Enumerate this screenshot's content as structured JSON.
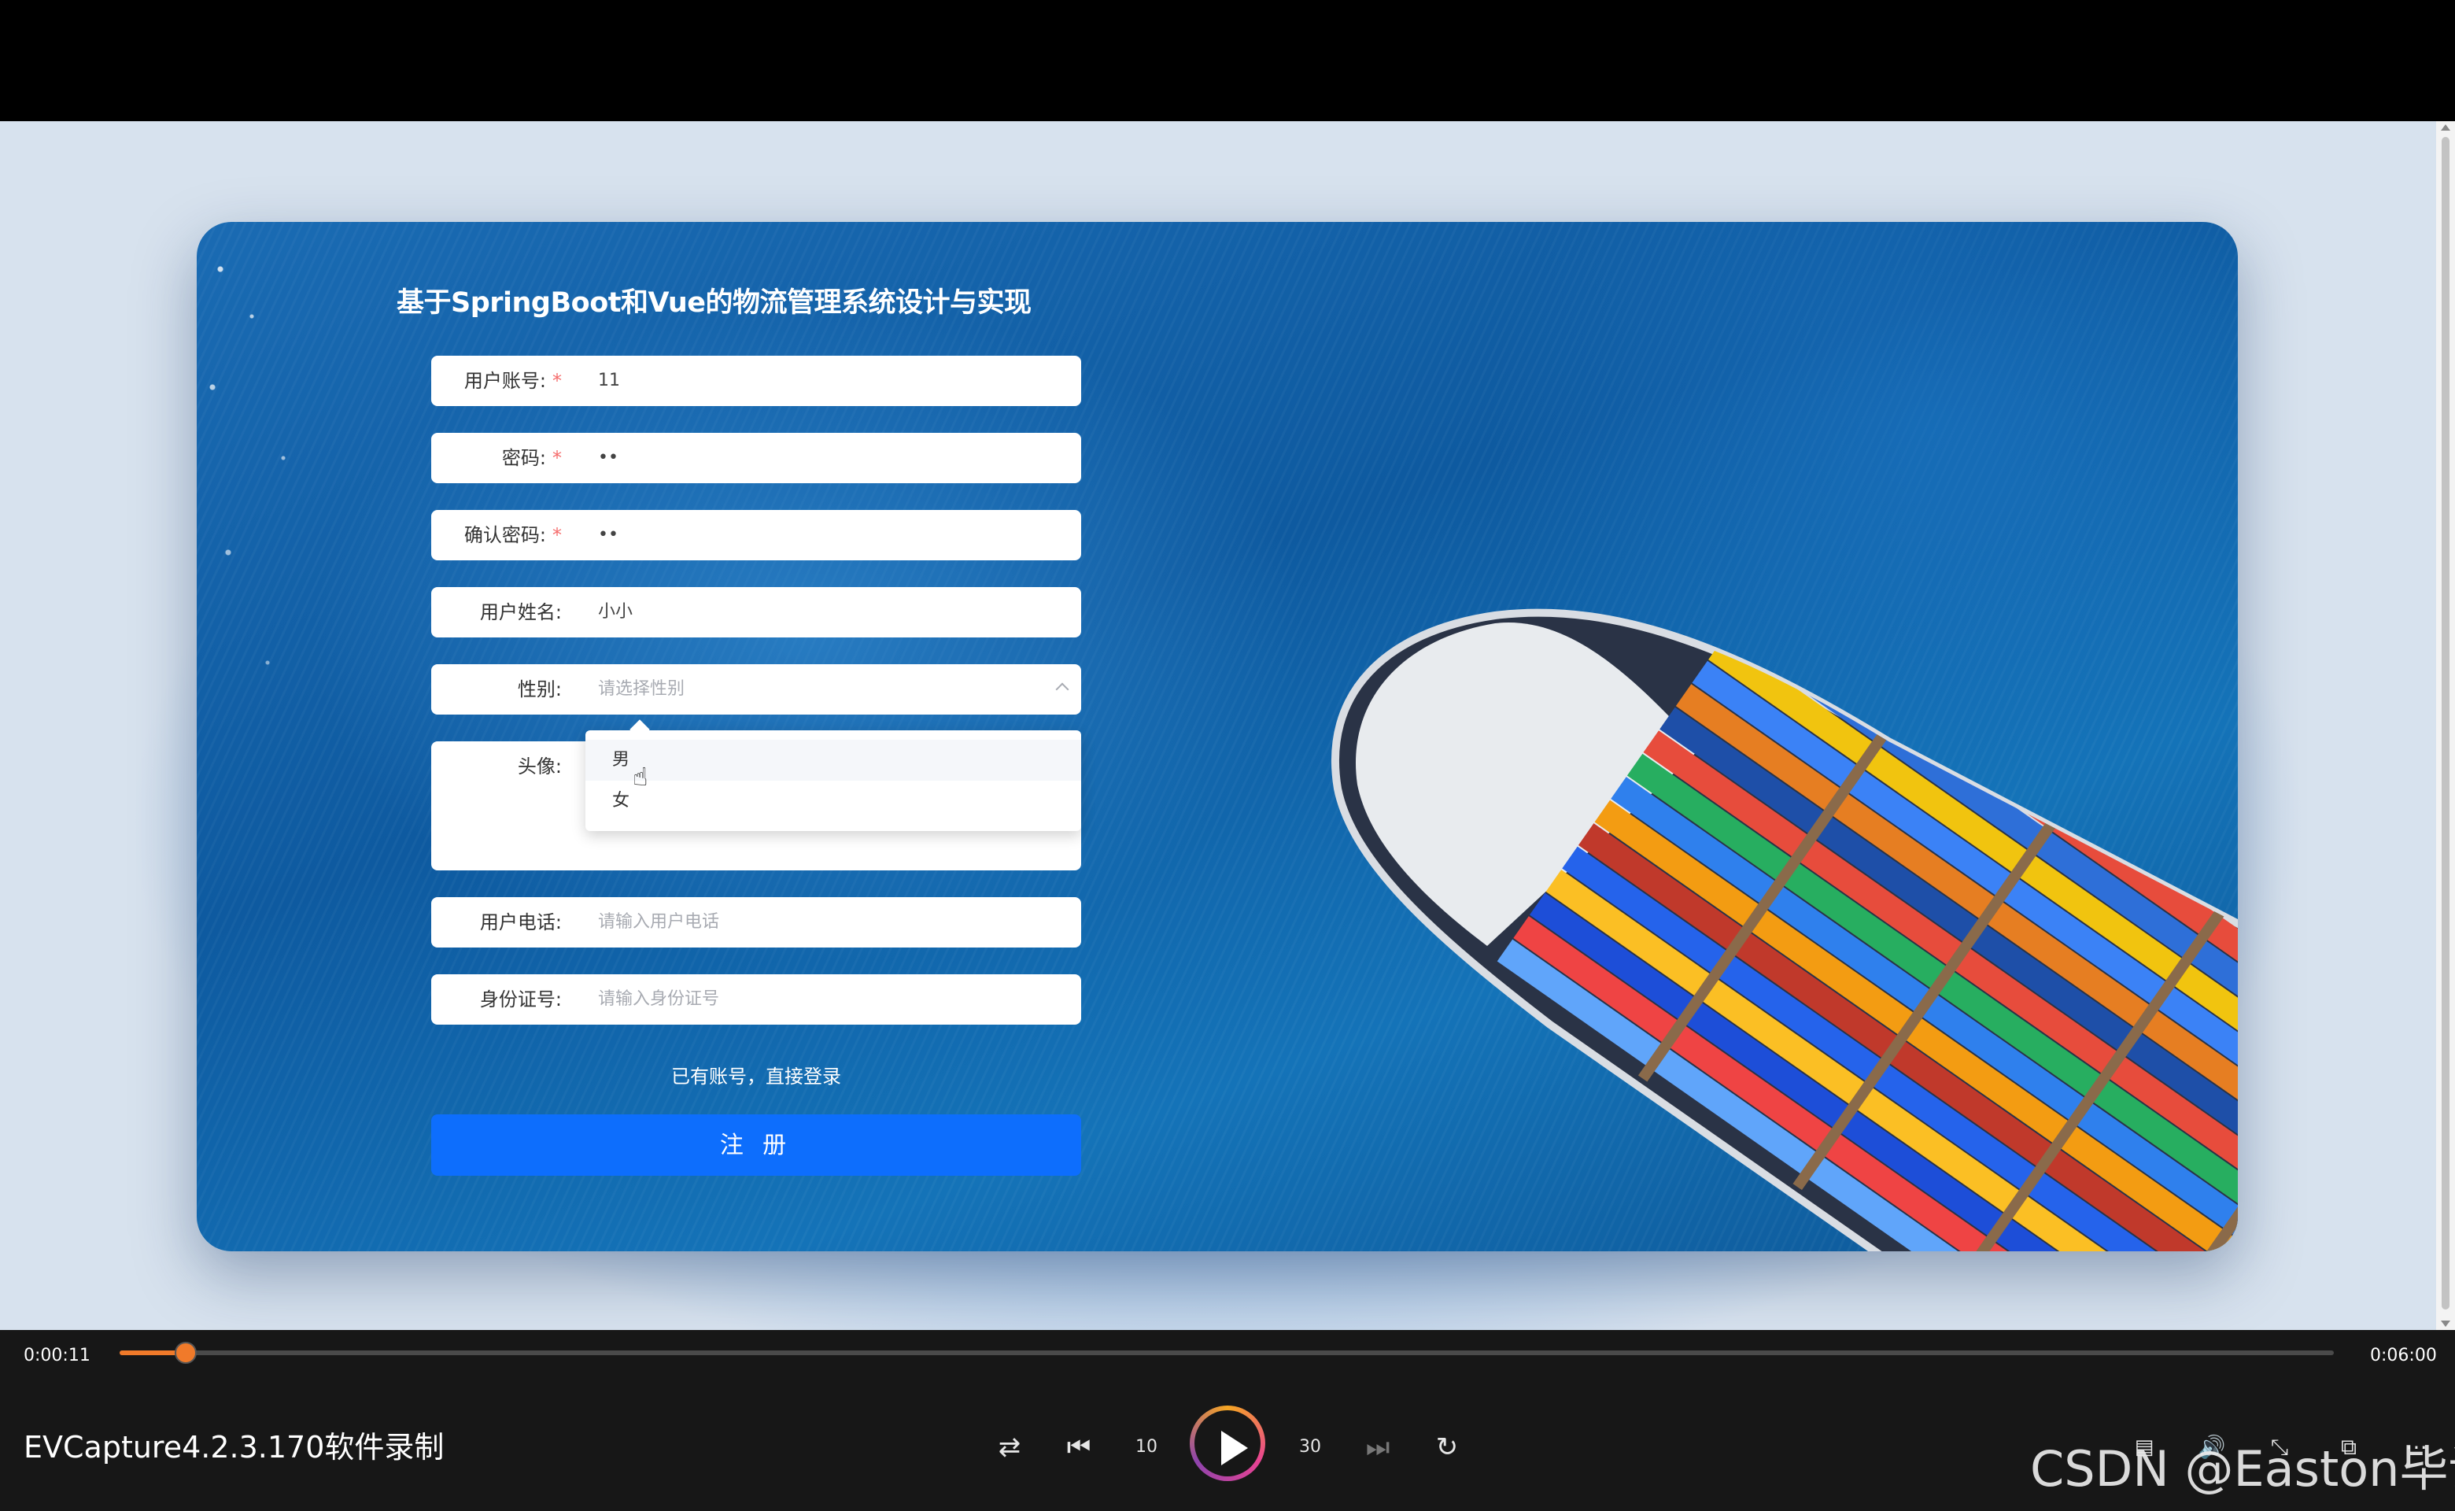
{
  "page": {
    "title": "基于SpringBoot和Vue的物流管理系统设计与实现"
  },
  "form": {
    "fields": [
      {
        "label": "用户账号:",
        "required": true,
        "value": "11",
        "placeholder": ""
      },
      {
        "label": "密码:",
        "required": true,
        "value": "••",
        "placeholder": ""
      },
      {
        "label": "确认密码:",
        "required": true,
        "value": "••",
        "placeholder": ""
      },
      {
        "label": "用户姓名:",
        "required": false,
        "value": "小小",
        "placeholder": ""
      },
      {
        "label": "性别:",
        "required": false,
        "value": "",
        "placeholder": "请选择性别"
      },
      {
        "label": "头像:",
        "required": false,
        "value": "",
        "placeholder": ""
      },
      {
        "label": "用户电话:",
        "required": false,
        "value": "",
        "placeholder": "请输入用户电话"
      },
      {
        "label": "身份证号:",
        "required": false,
        "value": "",
        "placeholder": "请输入身份证号"
      }
    ],
    "required_mark": "*",
    "gender_options": [
      "男",
      "女"
    ],
    "login_link": "已有账号，直接登录",
    "register_label": "注 册"
  },
  "player": {
    "current_time": "0:00:11",
    "total_time": "0:06:00",
    "progress": 0.03,
    "video_title": "EVCapture4.2.3.170软件录制",
    "skip_back": "10",
    "skip_forward": "30",
    "icons": [
      "shuffle-icon",
      "previous-icon",
      "rewind-10-icon",
      "play-icon",
      "forward-30-icon",
      "next-icon",
      "repeat-icon",
      "subtitles-icon",
      "volume-icon",
      "expand-icon",
      "mini-player-icon",
      "more-icon"
    ]
  },
  "watermark": "CSDN @Easton毕设",
  "colors": {
    "primary": "#0d6efd",
    "required": "#f56c6c",
    "progress": "#f07a2a"
  }
}
